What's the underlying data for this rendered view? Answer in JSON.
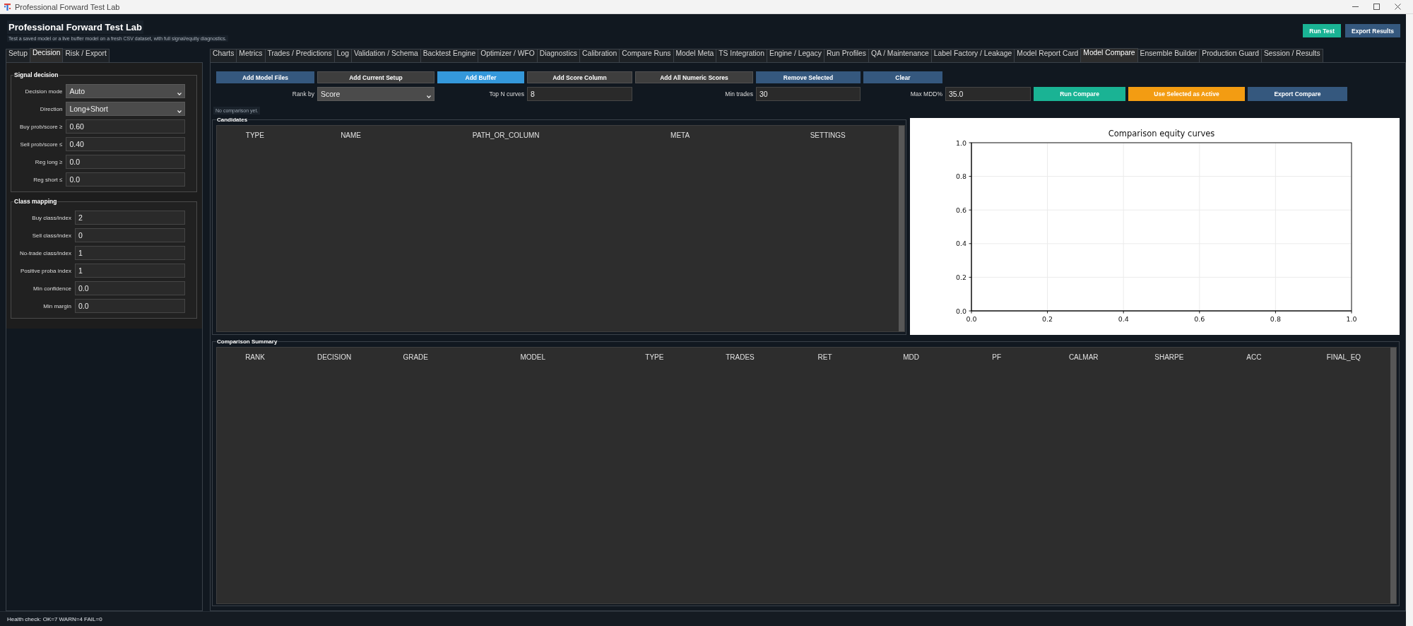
{
  "window": {
    "title": "Professional Forward Test Lab"
  },
  "header": {
    "title": "Professional Forward Test Lab",
    "subtitle": "Test a saved model or a live buffer model on a fresh CSV dataset, with full signal/equity diagnostics.",
    "buttons": [
      {
        "label": "Run Test",
        "kind": "success"
      },
      {
        "label": "Export Results",
        "kind": "primary"
      }
    ]
  },
  "sidebar": {
    "tabs": [
      {
        "label": "Setup",
        "selected": false
      },
      {
        "label": "Decision",
        "selected": true
      },
      {
        "label": "Risk / Export",
        "selected": false
      }
    ],
    "groups": [
      {
        "title": "Signal decision",
        "fields": [
          {
            "label": "Decision mode",
            "kind": "combo",
            "value": "Auto"
          },
          {
            "label": "Direction",
            "kind": "combo",
            "value": "Long+Short"
          },
          {
            "label": "Buy prob/score ≥",
            "kind": "input",
            "value": "0.60"
          },
          {
            "label": "Sell prob/score ≤",
            "kind": "input",
            "value": "0.40"
          },
          {
            "label": "Reg long ≥",
            "kind": "input",
            "value": "0.0"
          },
          {
            "label": "Reg short ≤",
            "kind": "input",
            "value": "0.0"
          }
        ]
      },
      {
        "title": "Class mapping",
        "fields": [
          {
            "label": "Buy class/index",
            "kind": "input",
            "value": "2"
          },
          {
            "label": "Sell class/index",
            "kind": "input",
            "value": "0"
          },
          {
            "label": "No-trade class/index",
            "kind": "input",
            "value": "1"
          },
          {
            "label": "Positive proba index",
            "kind": "input",
            "value": "1"
          },
          {
            "label": "Min confidence",
            "kind": "input",
            "value": "0.0"
          },
          {
            "label": "Min margin",
            "kind": "input",
            "value": "0.0"
          }
        ]
      }
    ]
  },
  "tabs": [
    {
      "label": "Charts",
      "selected": false
    },
    {
      "label": "Metrics",
      "selected": false
    },
    {
      "label": "Trades / Predictions",
      "selected": false
    },
    {
      "label": "Log",
      "selected": false
    },
    {
      "label": "Validation / Schema",
      "selected": false
    },
    {
      "label": "Backtest Engine",
      "selected": false
    },
    {
      "label": "Optimizer / WFO",
      "selected": false
    },
    {
      "label": "Diagnostics",
      "selected": false
    },
    {
      "label": "Calibration",
      "selected": false
    },
    {
      "label": "Compare Runs",
      "selected": false
    },
    {
      "label": "Model Meta",
      "selected": false
    },
    {
      "label": "TS Integration",
      "selected": false
    },
    {
      "label": "Engine / Legacy",
      "selected": false
    },
    {
      "label": "Run Profiles",
      "selected": false
    },
    {
      "label": "QA / Maintenance",
      "selected": false
    },
    {
      "label": "Label Factory / Leakage",
      "selected": false
    },
    {
      "label": "Model Report Card",
      "selected": false
    },
    {
      "label": "Model Compare",
      "selected": true
    },
    {
      "label": "Ensemble Builder",
      "selected": false
    },
    {
      "label": "Production Guard",
      "selected": false
    },
    {
      "label": "Session / Results",
      "selected": false
    }
  ],
  "toolbar": {
    "buttons": [
      {
        "label": "Add Model Files",
        "kind": "primary"
      },
      {
        "label": "Add Current Setup",
        "kind": "neutral"
      },
      {
        "label": "Add Buffer",
        "kind": "accent"
      },
      {
        "label": "Add Score Column",
        "kind": "neutral"
      },
      {
        "label": "Add All Numeric Scores",
        "kind": "neutral"
      },
      {
        "label": "Remove Selected",
        "kind": "primary"
      },
      {
        "label": "Clear",
        "kind": "primary"
      }
    ],
    "options": [
      {
        "label": "Rank by",
        "kind": "combo",
        "value": "Score"
      },
      {
        "label": "Top N curves",
        "kind": "input",
        "value": "8"
      },
      {
        "label": "Min trades",
        "kind": "input",
        "value": "30"
      },
      {
        "label": "Max MDD%",
        "kind": "input",
        "value": "35.0"
      }
    ],
    "actions": [
      {
        "label": "Run Compare",
        "kind": "success"
      },
      {
        "label": "Use Selected as Active",
        "kind": "warning"
      },
      {
        "label": "Export Compare",
        "kind": "primary"
      }
    ]
  },
  "status_message": "No comparison yet.",
  "candidates": {
    "title": "Candidates",
    "columns": [
      "TYPE",
      "NAME",
      "PATH_OR_COLUMN",
      "META",
      "SETTINGS"
    ]
  },
  "chart": {
    "chart_data": {
      "type": "line",
      "title": "Comparison equity curves",
      "grid": true,
      "xlim": [
        0,
        1
      ],
      "ylim": [
        0,
        1
      ],
      "xticks": [
        {
          "value": 0,
          "label": "0.0"
        },
        {
          "value": 0.2,
          "label": "0.2"
        },
        {
          "value": 0.4,
          "label": "0.4"
        },
        {
          "value": 0.6,
          "label": "0.6"
        },
        {
          "value": 0.8,
          "label": "0.8"
        },
        {
          "value": 1,
          "label": "1.0"
        }
      ],
      "yticks": [
        {
          "value": 0,
          "label": "0.0"
        },
        {
          "value": 0.2,
          "label": "0.2"
        },
        {
          "value": 0.4,
          "label": "0.4"
        },
        {
          "value": 0.6,
          "label": "0.6"
        },
        {
          "value": 0.8,
          "label": "0.8"
        },
        {
          "value": 1,
          "label": "1.0"
        }
      ]
    }
  },
  "summary": {
    "title": "Comparison Summary",
    "columns": [
      "RANK",
      "DECISION",
      "GRADE",
      "MODEL",
      "TYPE",
      "TRADES",
      "RET",
      "MDD",
      "PF",
      "CALMAR",
      "SHARPE",
      "ACC",
      "FINAL_EQ"
    ]
  },
  "status_bar": "Health check: OK=7 WARN=4 FAIL=0"
}
